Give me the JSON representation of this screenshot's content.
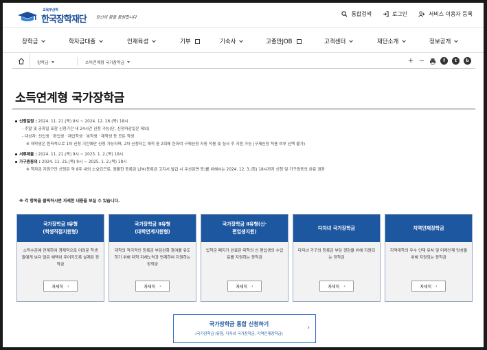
{
  "header": {
    "logo_sub": "교육부산하",
    "logo_name": "한국장학재단",
    "logo_slogan": "당신의 꿈을 응원합니다",
    "util": [
      {
        "label": "통합검색",
        "icon": "search-icon"
      },
      {
        "label": "로그인",
        "icon": "login-icon"
      },
      {
        "label": "서비스 이용자 등록",
        "icon": "user-add-icon"
      }
    ]
  },
  "nav": [
    {
      "label": "장학금",
      "type": "dropdown"
    },
    {
      "label": "학자금대출",
      "type": "dropdown"
    },
    {
      "label": "인재육성",
      "type": "dropdown"
    },
    {
      "label": "기부",
      "type": "external"
    },
    {
      "label": "기숙사",
      "type": "dropdown"
    },
    {
      "label": "고졸만JOB",
      "type": "external"
    },
    {
      "label": "고객센터",
      "type": "dropdown"
    },
    {
      "label": "재단소개",
      "type": "dropdown"
    },
    {
      "label": "정보공개",
      "type": "dropdown"
    }
  ],
  "breadcrumb": {
    "level1": "장학금",
    "level2": "소득연계형 국가장학금",
    "tools": [
      "+",
      "−",
      "print",
      "f",
      "t",
      "b"
    ]
  },
  "page_title": "소득연계형 국가장학금",
  "info": {
    "schedule_label": "신청일정 :",
    "schedule_value": "2024. 11. 21.(목) 9시 ~ 2024. 12. 26.(목) 18시",
    "schedule_note1": "- 주말 및 공휴일 포함 신청기간 내 24시간 신청 가능(단, 신청마감일은 제외)",
    "schedule_note2": "- 대상자: 신입생 · 편입생 · 재입학생 · 복학생 · 재학생 등 모든 학생",
    "schedule_note3": "※ 재학생은 원칙적으로 1차 신청 기간에만 신청 가능하며, 2차 신청자는 재학 중 2회에 한하여 구제신청 자동 적용 및 심사 후 지원 가능 (구제신청 적용 여부 선택 불가)",
    "docs_label": "서류제출 :",
    "docs_value": "2024. 11. 21.(목) 9시 ~ 2025. 1. 2.(목) 18시",
    "consent_label": "가구원동의 :",
    "consent_value": "2024. 11. 21.(목) 9시 ~ 2025. 1. 2.(목) 18시",
    "consent_note": "※ 학자금 지원구간 산정은 약 8주 내외 소요되므로, 원활한 등록금 납부(등록금 고지서 발급 시 우선감면 등)를 위해서는 2024. 12. 3.(화) 18시까지 신청 및 가구원동의 완료 권장"
  },
  "notice": "※ 각 항목을 클릭하시면 자세한 내용을 보실 수 있습니다.",
  "cards": [
    {
      "title1": "국가장학금 Ⅰ유형",
      "title2": "(학생직접지원형)",
      "desc": "소득수준에 연계하여 경제적으로 어려운 학생들에게 보다 많은 혜택이 주어지도록 설계된 장학금",
      "button": "자세히"
    },
    {
      "title1": "국가장학금 Ⅱ유형",
      "title2": "(대학연계지원형)",
      "desc": "대학의 적극적인 등록금 부담완화 참여를 유도하기 위해 대학 자체노력과 연계하여 지원하는 장학금",
      "button": "자세히"
    },
    {
      "title1": "국가장학금 Ⅱ유형(신·",
      "title2": "편입생지원)",
      "desc": "입학금 폐지가 완료된 대학의 신 편입생의 수업료를 지원하는 장학금",
      "button": "자세히"
    },
    {
      "title1": "다자녀 국가장학금",
      "title2": "",
      "desc": "다자녀 가구의 등록금 부담 경감을 위해 지원되는 장학금",
      "button": "자세히"
    },
    {
      "title1": "지역인재장학금",
      "title2": "",
      "desc": "지역대학의 우수 인재 유치 및 미래인재 양성을 위해 지원되는 장학금",
      "button": "자세히"
    }
  ],
  "apply": {
    "title": "국가장학금 통합 신청하기",
    "sub": "(국가장학금 Ⅰ유형, 다자녀 국가장학금, 지역인재장학금)"
  },
  "colors": {
    "brand_blue": "#1d57a0",
    "border_blue": "#2b6cc4",
    "card_bg": "#f2f2f2"
  }
}
